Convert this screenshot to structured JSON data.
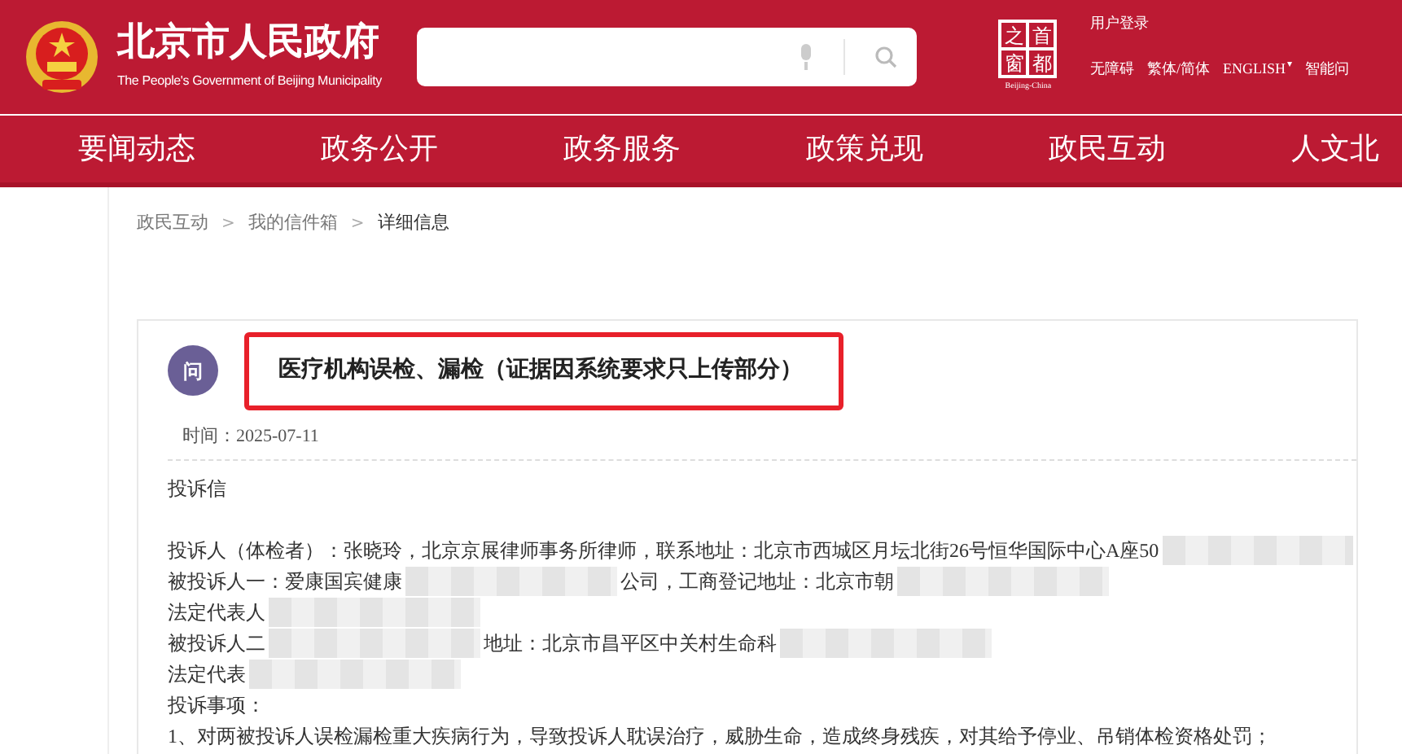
{
  "header": {
    "site_title": "北京市人民政府",
    "site_subtitle": "The People's Government of Beijing Municipality",
    "capital_logo": {
      "chars": [
        "之",
        "首",
        "窗",
        "都"
      ],
      "caption": "Beijing-China"
    },
    "user_login": "用户登录",
    "links": [
      "无障碍",
      "繁体/简体",
      "ENGLISH",
      "智能问"
    ],
    "english_caret": "▾"
  },
  "nav": [
    {
      "label": "要闻动态",
      "selected": false
    },
    {
      "label": "政务公开",
      "selected": false
    },
    {
      "label": "政务服务",
      "selected": false
    },
    {
      "label": "政策兑现",
      "selected": false
    },
    {
      "label": "政民互动",
      "selected": false
    },
    {
      "label": "人文北",
      "selected": false
    }
  ],
  "breadcrumb": [
    {
      "label": "政民互动",
      "current": false
    },
    {
      "label": "我的信件箱",
      "current": false
    },
    {
      "label": "详细信息",
      "current": true
    }
  ],
  "breadcrumb_separator": ">",
  "letter": {
    "badge": "问",
    "title": "医疗机构误检、漏检（证据因系统要求只上传部分）",
    "highlighted": true,
    "time_label": "时间：",
    "time": "2025-07-11",
    "heading": "投诉信",
    "lines": [
      {
        "segments": [
          {
            "kind": "text",
            "text": "投诉人（体检者）：张晓玲，北京京展律师事务所律师，联系地址：北京市西城区月坛北街26号恒华国际中心A座50"
          },
          {
            "kind": "redaction"
          }
        ]
      },
      {
        "segments": [
          {
            "kind": "text",
            "text": "被投诉人一：爱康国宾健康"
          },
          {
            "kind": "redaction"
          },
          {
            "kind": "text",
            "text": "公司，工商登记地址：北京市朝"
          },
          {
            "kind": "redaction"
          }
        ]
      },
      {
        "segments": [
          {
            "kind": "text",
            "text": "法定代表人"
          },
          {
            "kind": "redaction"
          }
        ]
      },
      {
        "segments": [
          {
            "kind": "text",
            "text": "被投诉人二"
          },
          {
            "kind": "redaction"
          },
          {
            "kind": "text",
            "text": "地址：北京市昌平区中关村生命科"
          },
          {
            "kind": "redaction"
          }
        ]
      },
      {
        "segments": [
          {
            "kind": "text",
            "text": "法定代表"
          },
          {
            "kind": "redaction"
          }
        ]
      },
      {
        "segments": [
          {
            "kind": "text",
            "text": "投诉事项："
          }
        ]
      },
      {
        "segments": [
          {
            "kind": "text",
            "text": "1、对两被投诉人误检漏检重大疾病行为，导致投诉人耽误治疗，威胁生命，造成终身残疾，对其给予停业、吊销体检资格处罚；"
          }
        ]
      }
    ]
  }
}
